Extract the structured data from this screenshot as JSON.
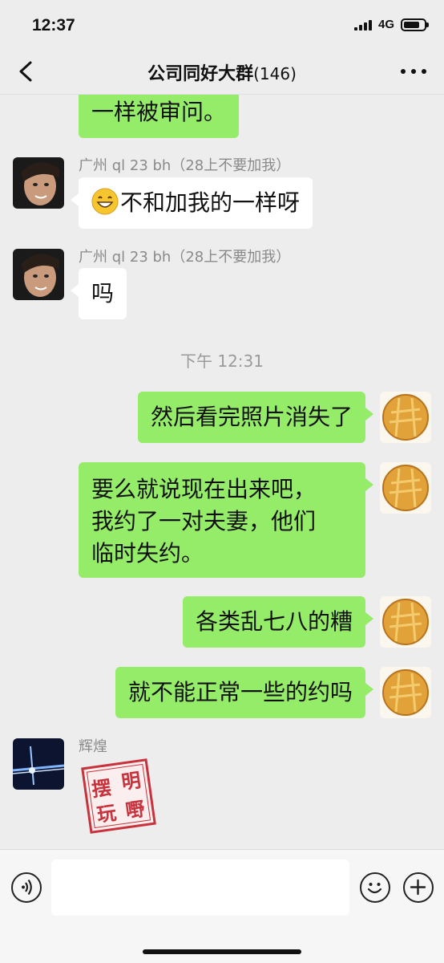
{
  "status_bar": {
    "time": "12:37",
    "network": "4G"
  },
  "header": {
    "title": "公司同好大群",
    "member_count": "(146)"
  },
  "messages": {
    "m0": {
      "text": "一样被审问。"
    },
    "m1": {
      "sender": "广州 ql 23 bh（28上不要加我）",
      "text": "不和加我的一样呀"
    },
    "m2": {
      "sender": "广州 ql 23 bh（28上不要加我）",
      "text": "吗"
    },
    "timestamp": "下午 12:31",
    "m3": {
      "text": "然后看完照片消失了"
    },
    "m4": {
      "line1": "要么就说现在出来吧，",
      "line2": "我约了一对夫妻，他们",
      "line3": "临时失约。"
    },
    "m5": {
      "text": "各类乱七八的糟"
    },
    "m6": {
      "text": "就不能正常一些的约吗"
    },
    "m7": {
      "sender": "辉煌",
      "sticker_text": [
        "摆",
        "明",
        "玩",
        "嘢"
      ]
    }
  },
  "input_bar": {
    "placeholder": ""
  },
  "colors": {
    "sent_bubble": "#95ec69",
    "received_bubble": "#ffffff",
    "background": "#ededed"
  }
}
